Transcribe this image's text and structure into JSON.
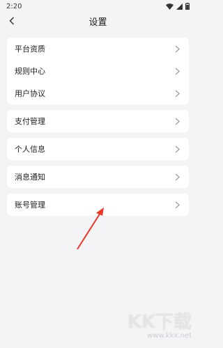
{
  "status_bar": {
    "time": "2:20"
  },
  "header": {
    "title": "设置"
  },
  "groups": [
    {
      "items": [
        {
          "label": "平台资质"
        },
        {
          "label": "规则中心"
        },
        {
          "label": "用户协议"
        }
      ]
    },
    {
      "items": [
        {
          "label": "支付管理"
        }
      ]
    },
    {
      "items": [
        {
          "label": "个人信息"
        }
      ]
    },
    {
      "items": [
        {
          "label": "消息通知"
        }
      ]
    },
    {
      "items": [
        {
          "label": "账号管理"
        }
      ]
    }
  ],
  "watermark": {
    "logo": "KK下载",
    "url": "www.kkx.net"
  },
  "colors": {
    "annotation_arrow": "#e8382a",
    "background": "#f4f4f6",
    "card": "#ffffff"
  },
  "icons": [
    "back-arrow-icon",
    "wifi-icon",
    "signal-icon",
    "battery-icon",
    "chevron-right-icon"
  ]
}
